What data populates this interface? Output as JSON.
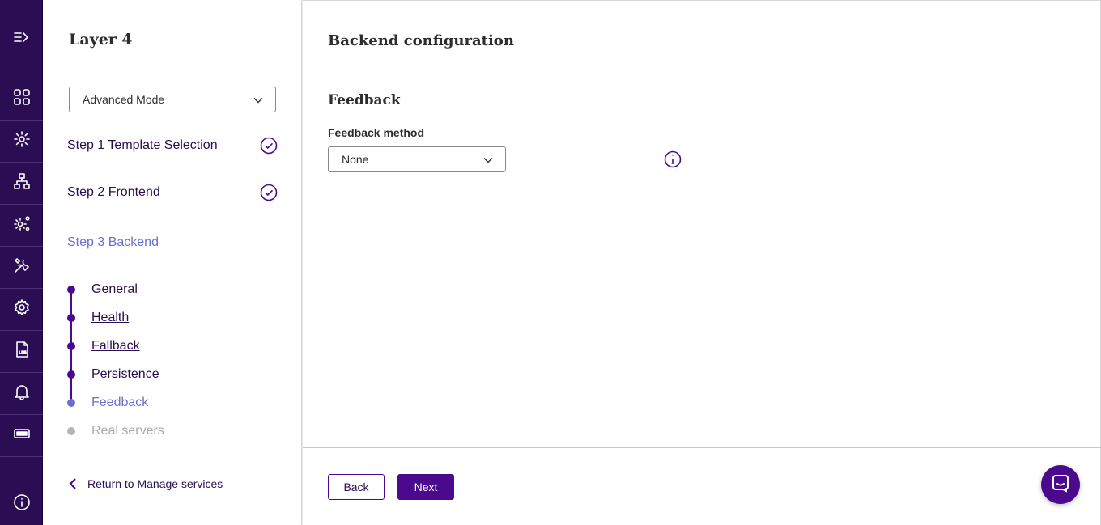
{
  "rail": {
    "items": [
      {
        "icon": "expand-menu-icon"
      },
      {
        "icon": "dashboard-grid-icon"
      },
      {
        "icon": "services-gear-icon"
      },
      {
        "icon": "network-topology-icon"
      },
      {
        "icon": "system-gears-icon"
      },
      {
        "icon": "tools-icon"
      },
      {
        "icon": "settings-gear-icon"
      },
      {
        "icon": "log-file-icon"
      },
      {
        "icon": "notifications-bell-icon"
      },
      {
        "icon": "ticket-icon"
      },
      {
        "icon": "info-icon"
      }
    ]
  },
  "wizard": {
    "title": "Layer 4",
    "mode": {
      "selected": "Advanced Mode"
    },
    "steps": [
      {
        "label": "Step 1 Template Selection",
        "completed": true
      },
      {
        "label": "Step 2 Frontend",
        "completed": true
      },
      {
        "label": "Step 3 Backend",
        "current": true
      }
    ],
    "substeps": [
      {
        "label": "General",
        "state": "done"
      },
      {
        "label": "Health",
        "state": "done"
      },
      {
        "label": "Fallback",
        "state": "done"
      },
      {
        "label": "Persistence",
        "state": "done"
      },
      {
        "label": "Feedback",
        "state": "current"
      },
      {
        "label": "Real servers",
        "state": "disabled"
      }
    ],
    "return_label": "Return to Manage services"
  },
  "main": {
    "title": "Backend configuration",
    "section_title": "Feedback",
    "feedback_method": {
      "label": "Feedback method",
      "selected": "None"
    }
  },
  "footer": {
    "back_label": "Back",
    "next_label": "Next"
  },
  "colors": {
    "rail_bg": "#2a0d52",
    "accent": "#4b0a8e",
    "current_step": "#6a6fd0",
    "disabled": "#a8a8a8"
  }
}
